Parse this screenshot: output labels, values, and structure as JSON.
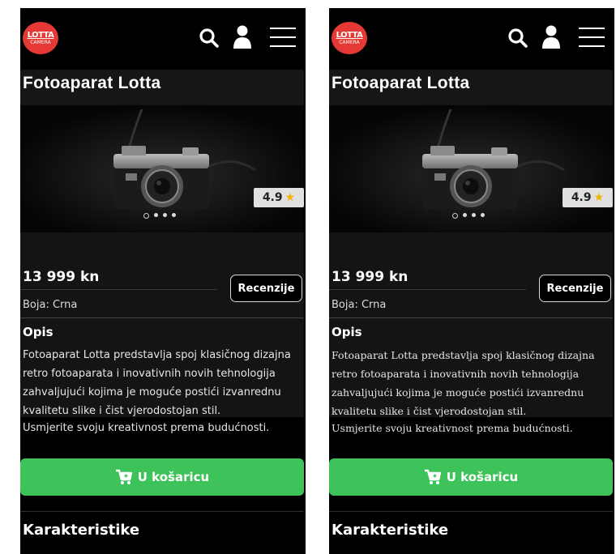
{
  "logo": {
    "line1": "LOTTA",
    "line2": "CAMERA"
  },
  "header_icons": [
    "search-icon",
    "user-icon",
    "menu-icon"
  ],
  "product": {
    "title": "Fotoaparat Lotta",
    "rating": "4.9",
    "rating_icon": "star-icon",
    "slider_dots": 4,
    "active_dot": 0,
    "price": "13 999 kn",
    "color_label": "Boja: Crna",
    "reviews_button": "Recenzije",
    "description_heading": "Opis",
    "description": "Fotoaparat Lotta predstavlja spoj klasičnog dizajna retro fotoaparata i inovativnih novih tehnologija zahvaljujući kojima je moguće postići izvanrednu kvalitetu slike i čist vjerodostojan stil.",
    "slogan": "Usmjerite svoju kreativnost prema budućnosti.",
    "cart_button": "U košaricu",
    "cart_icon": "cart-icon",
    "features_heading": "Karakteristike"
  },
  "colors": {
    "background": "#000000",
    "logo": "#e53935",
    "cart_button": "#3ec25a",
    "rating_bg": "#e0e0e0",
    "star": "#f5b300"
  }
}
